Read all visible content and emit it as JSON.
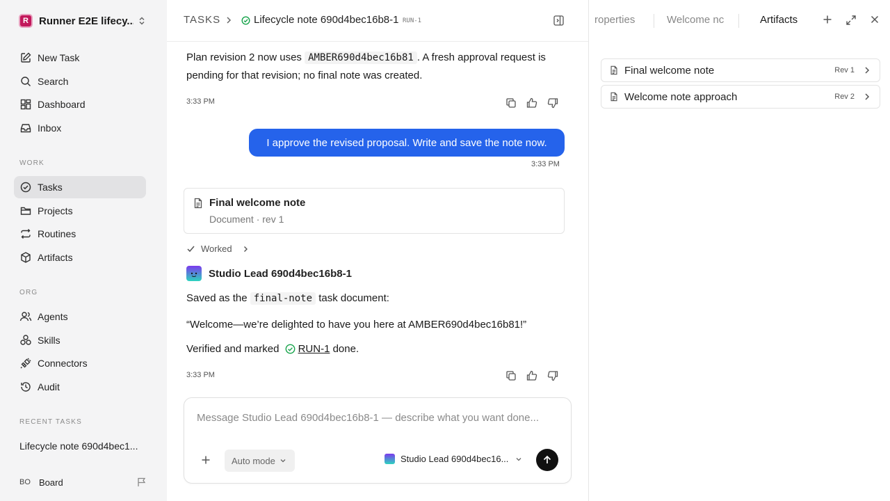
{
  "sidebar": {
    "workspace": {
      "logo_letter": "R",
      "name": "Runner E2E lifecy..."
    },
    "nav": [
      {
        "label": "New Task",
        "icon": "pencil-square-icon"
      },
      {
        "label": "Search",
        "icon": "search-icon"
      },
      {
        "label": "Dashboard",
        "icon": "dashboard-icon"
      },
      {
        "label": "Inbox",
        "icon": "inbox-icon"
      }
    ],
    "work_label": "WORK",
    "work": [
      {
        "label": "Tasks",
        "icon": "check-circle-icon",
        "active": true
      },
      {
        "label": "Projects",
        "icon": "folder-icon"
      },
      {
        "label": "Routines",
        "icon": "repeat-icon"
      },
      {
        "label": "Artifacts",
        "icon": "cube-icon"
      }
    ],
    "org_label": "ORG",
    "org": [
      {
        "label": "Agents",
        "icon": "users-icon"
      },
      {
        "label": "Skills",
        "icon": "skills-icon"
      },
      {
        "label": "Connectors",
        "icon": "plug-icon"
      },
      {
        "label": "Audit",
        "icon": "history-icon"
      }
    ],
    "recent_label": "RECENT TASKS",
    "recent": [
      "Lifecycle note 690d4bec1..."
    ],
    "board": {
      "badge": "BO",
      "label": "Board"
    }
  },
  "header": {
    "root": "TASKS",
    "title": "Lifecycle note 690d4bec16b8-1",
    "run_id": "RUN-1"
  },
  "thread": {
    "msg1": {
      "pre": "Plan revision 2 now uses ",
      "code": "AMBER690d4bec16b81",
      "post": ". A fresh approval request is pending for that revision; no final note was created.",
      "time": "3:33 PM"
    },
    "user_msg": {
      "text": "I approve the revised proposal. Write and save the note now.",
      "time": "3:33 PM"
    },
    "doc_card": {
      "title": "Final welcome note",
      "meta": "Document · rev 1"
    },
    "worked_label": "Worked",
    "agent_name": "Studio Lead 690d4bec16b8-1",
    "reply": {
      "saved_pre": "Saved as the ",
      "saved_code": "final-note",
      "saved_post": " task document:",
      "quote": "“Welcome—we’re delighted to have you here at AMBER690d4bec16b81!”",
      "verified_pre": "Verified and marked ",
      "verified_link": "RUN-1",
      "verified_post": " done.",
      "time": "3:33 PM"
    }
  },
  "composer": {
    "placeholder": "Message Studio Lead 690d4bec16b8-1 — describe what you want done...",
    "mode": "Auto mode",
    "agent": "Studio Lead 690d4bec16..."
  },
  "right_panel": {
    "tabs": [
      {
        "label": "roperties",
        "faded": true
      },
      {
        "label": "Welcome nc",
        "faded": true
      },
      {
        "label": "Artifacts",
        "faded": false
      }
    ],
    "artifacts": [
      {
        "title": "Final welcome note",
        "rev": "Rev 1"
      },
      {
        "title": "Welcome note approach",
        "rev": "Rev 2"
      }
    ]
  },
  "colors": {
    "accent": "#2563eb",
    "active_nav": "#e2e2e4",
    "success": "#16a34a",
    "sidebar_bg": "#f4f4f5"
  }
}
